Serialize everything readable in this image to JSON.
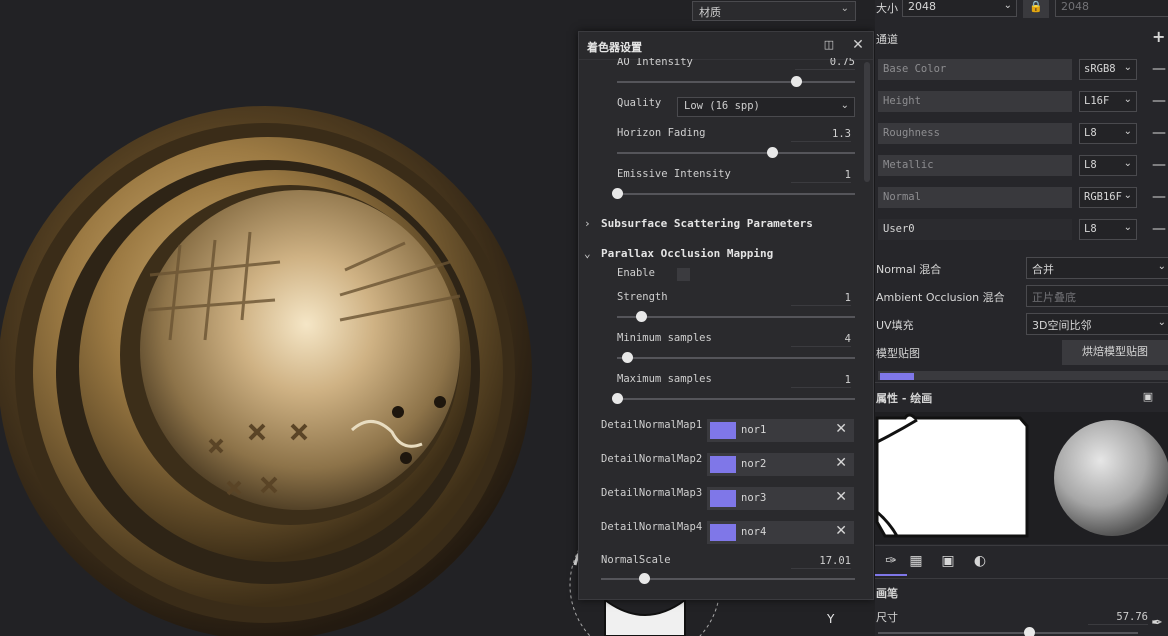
{
  "viewport": {
    "view_dropdown": "材质",
    "axis_label": "Y"
  },
  "shader_panel": {
    "title": "着色器设置",
    "dock_icon": "dock-icon",
    "close_icon": "close-icon",
    "ao_intensity": {
      "label": "AO Intensity",
      "value": "0.75",
      "fraction": 0.75
    },
    "quality": {
      "label": "Quality",
      "value": "Low (16 spp)"
    },
    "horizon_fading": {
      "label": "Horizon Fading",
      "value": "1.3",
      "fraction": 0.65
    },
    "emissive_intensity": {
      "label": "Emissive Intensity",
      "value": "1",
      "fraction": 0.0
    },
    "sss_section": "Subsurface Scattering Parameters",
    "pom_section": "Parallax Occlusion Mapping",
    "enable_label": "Enable",
    "strength": {
      "label": "Strength",
      "value": "1",
      "fraction": 0.1
    },
    "min_samples": {
      "label": "Minimum samples",
      "value": "4",
      "fraction": 0.04
    },
    "max_samples": {
      "label": "Maximum samples",
      "value": "1",
      "fraction": 0.0
    },
    "detail_maps": [
      {
        "label": "DetailNormalMap1",
        "texture": "nor1"
      },
      {
        "label": "DetailNormalMap2",
        "texture": "nor2"
      },
      {
        "label": "DetailNormalMap3",
        "texture": "nor3"
      },
      {
        "label": "DetailNormalMap4",
        "texture": "nor4"
      }
    ],
    "normal_scale": {
      "label": "NormalScale",
      "value": "17.01",
      "fraction": 0.17
    }
  },
  "right_panel": {
    "size_label": "大小",
    "size_value": "2048",
    "size_value_locked": "2048",
    "channels_title": "通道",
    "channels": [
      {
        "name": "Base Color",
        "format": "sRGB8"
      },
      {
        "name": "Height",
        "format": "L16F"
      },
      {
        "name": "Roughness",
        "format": "L8"
      },
      {
        "name": "Metallic",
        "format": "L8"
      },
      {
        "name": "Normal",
        "format": "RGB16F"
      },
      {
        "name": "User0",
        "format": "L8"
      }
    ],
    "normal_blend": {
      "label": "Normal 混合",
      "value": "合并"
    },
    "ao_blend": {
      "label": "Ambient Occlusion 混合",
      "value": "正片叠底"
    },
    "uv_padding": {
      "label": "UV填充",
      "value": "3D空间比邻"
    },
    "model_maps": {
      "label": "模型贴图",
      "button": "烘焙模型贴图"
    },
    "properties_title": "属性 - 绘画",
    "brush_title": "画笔",
    "size": {
      "label": "尺寸",
      "value": "57.76",
      "fraction": 0.58
    }
  },
  "colors": {
    "accent_normal_map": "#7f77e8",
    "panel_bg": "#2a2a2d"
  }
}
